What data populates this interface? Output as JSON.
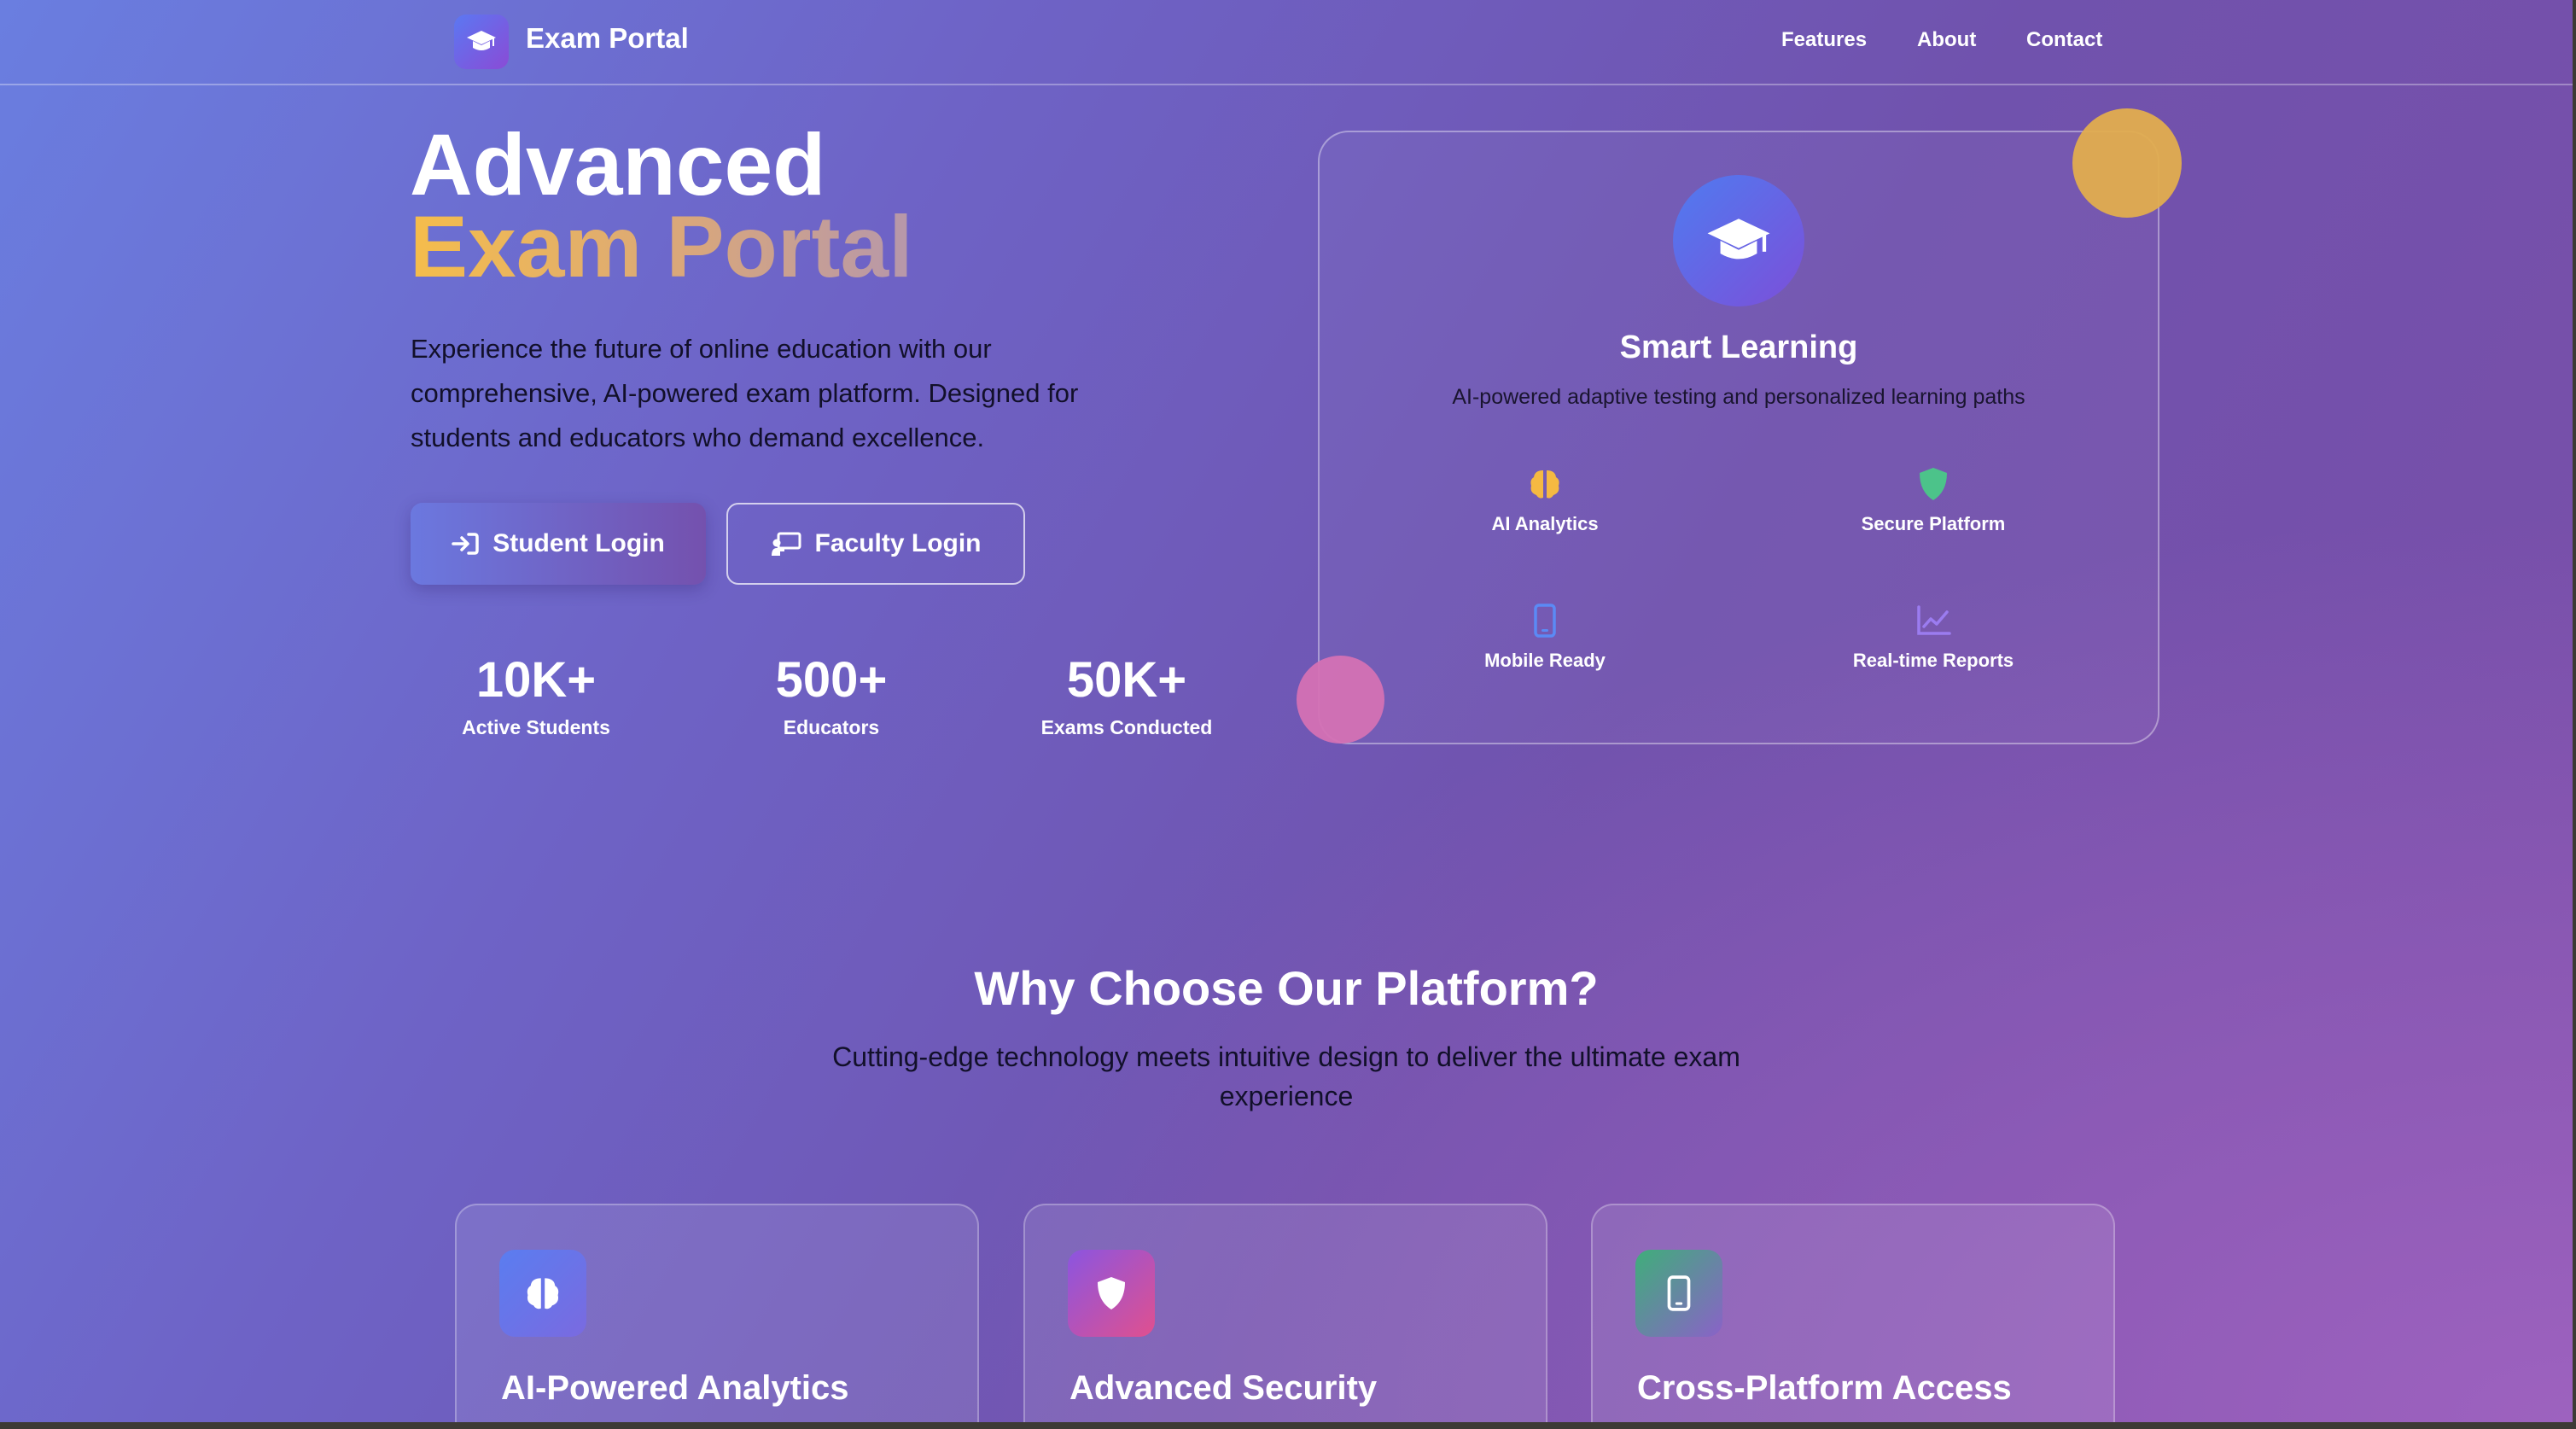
{
  "nav": {
    "brand": "Exam Portal",
    "links": [
      "Features",
      "About",
      "Contact"
    ]
  },
  "hero": {
    "title_line1": "Advanced",
    "title_line2": "Exam Portal",
    "description": "Experience the future of online education with our comprehensive, AI-powered exam platform. Designed for students and educators who demand excellence.",
    "student_login": "Student Login",
    "faculty_login": "Faculty Login",
    "stats": [
      {
        "value": "10K+",
        "label": "Active Students"
      },
      {
        "value": "500+",
        "label": "Educators"
      },
      {
        "value": "50K+",
        "label": "Exams Conducted"
      }
    ]
  },
  "card": {
    "title": "Smart Learning",
    "subtitle": "AI-powered adaptive testing and personalized learning paths",
    "features": [
      {
        "label": "AI Analytics",
        "icon": "brain-icon",
        "color": "#f5b942"
      },
      {
        "label": "Secure Platform",
        "icon": "shield-icon",
        "color": "#4cc38a"
      },
      {
        "label": "Mobile Ready",
        "icon": "mobile-icon",
        "color": "#5b8af5"
      },
      {
        "label": "Real-time Reports",
        "icon": "chart-line-icon",
        "color": "#9b7cf0"
      }
    ]
  },
  "why": {
    "title": "Why Choose Our Platform?",
    "subtitle": "Cutting-edge technology meets intuitive design to deliver the ultimate exam experience",
    "cards": [
      {
        "title": "AI-Powered Analytics",
        "icon": "brain-icon"
      },
      {
        "title": "Advanced Security",
        "icon": "shield-icon"
      },
      {
        "title": "Cross-Platform Access",
        "icon": "mobile-icon"
      }
    ]
  },
  "colors": {
    "accent_gold": "#f5bd4b",
    "accent_pink": "#d471b4",
    "brand_blue": "#5b78f2",
    "brand_purple": "#8a4bd6"
  }
}
